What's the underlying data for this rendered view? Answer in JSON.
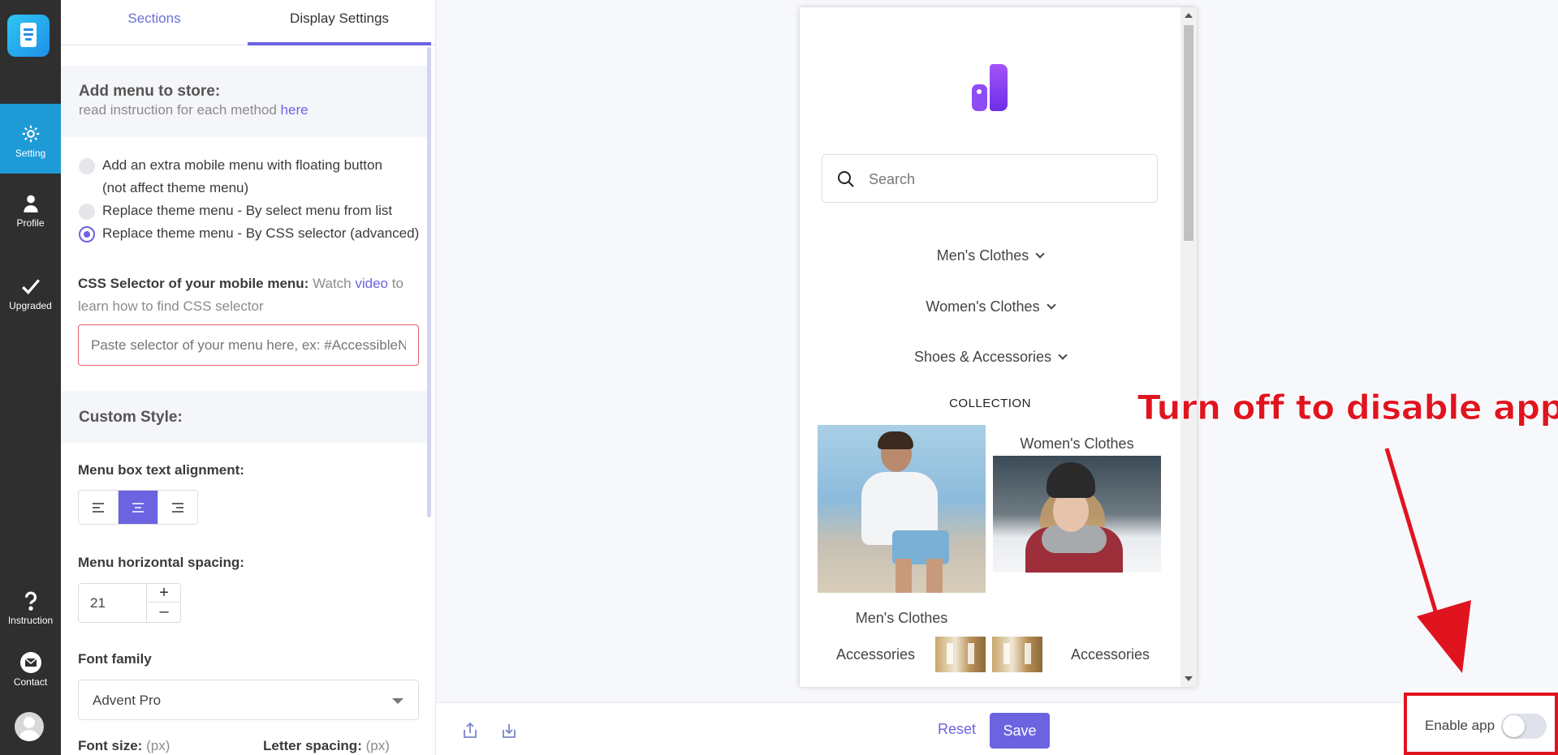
{
  "rail": {
    "items": [
      {
        "label": "Setting",
        "icon": "gear-icon"
      },
      {
        "label": "Profile",
        "icon": "user-icon"
      },
      {
        "label": "Upgraded",
        "icon": "check-icon"
      },
      {
        "label": "Instruction",
        "icon": "question-icon"
      },
      {
        "label": "Contact",
        "icon": "mail-icon"
      }
    ]
  },
  "tabs": {
    "sections": "Sections",
    "display": "Display Settings"
  },
  "add_menu": {
    "title": "Add menu to store:",
    "subtitle": "read instruction for each method",
    "link": "here",
    "options": [
      "Add an extra mobile menu with floating button",
      "(not affect theme menu)",
      "Replace theme menu - By select menu from list",
      "Replace theme menu - By CSS selector (advanced)"
    ],
    "selected_index": 2
  },
  "css_selector": {
    "label": "CSS Selector of your mobile menu:",
    "watch": "Watch",
    "video_link": "video",
    "to": "to",
    "line2": "learn how to find CSS selector",
    "placeholder": "Paste selector of your menu here, ex: #AccessibleN"
  },
  "custom_style": {
    "title": "Custom Style:",
    "alignment_label": "Menu box text alignment:",
    "alignment_selected": "center",
    "spacing_label": "Menu horizontal spacing:",
    "spacing_value": "21",
    "stepper_plus": "+",
    "stepper_minus": "–",
    "font_family_label": "Font family",
    "font_family_value": "Advent Pro",
    "font_size_label": "Font size:",
    "font_size_unit": "(px)",
    "letter_spacing_label": "Letter spacing:",
    "letter_spacing_unit": "(px)"
  },
  "preview": {
    "search_placeholder": "Search",
    "menu_items": [
      "Men's Clothes",
      "Women's Clothes",
      "Shoes & Accessories"
    ],
    "collection_title": "COLLECTION",
    "captions": {
      "womens": "Women's Clothes",
      "mens": "Men's Clothes",
      "acc_left": "Accessories",
      "acc_right": "Accessories"
    }
  },
  "annotation": {
    "text": "Turn off to disable app",
    "color": "#e0141f"
  },
  "bottom_bar": {
    "reset": "Reset",
    "save": "Save",
    "enable_label": "Enable app",
    "enabled": false
  },
  "colors": {
    "accent": "#6b63e0",
    "rail_bg": "#2f2f2f",
    "rail_active": "#1e9bd7"
  }
}
